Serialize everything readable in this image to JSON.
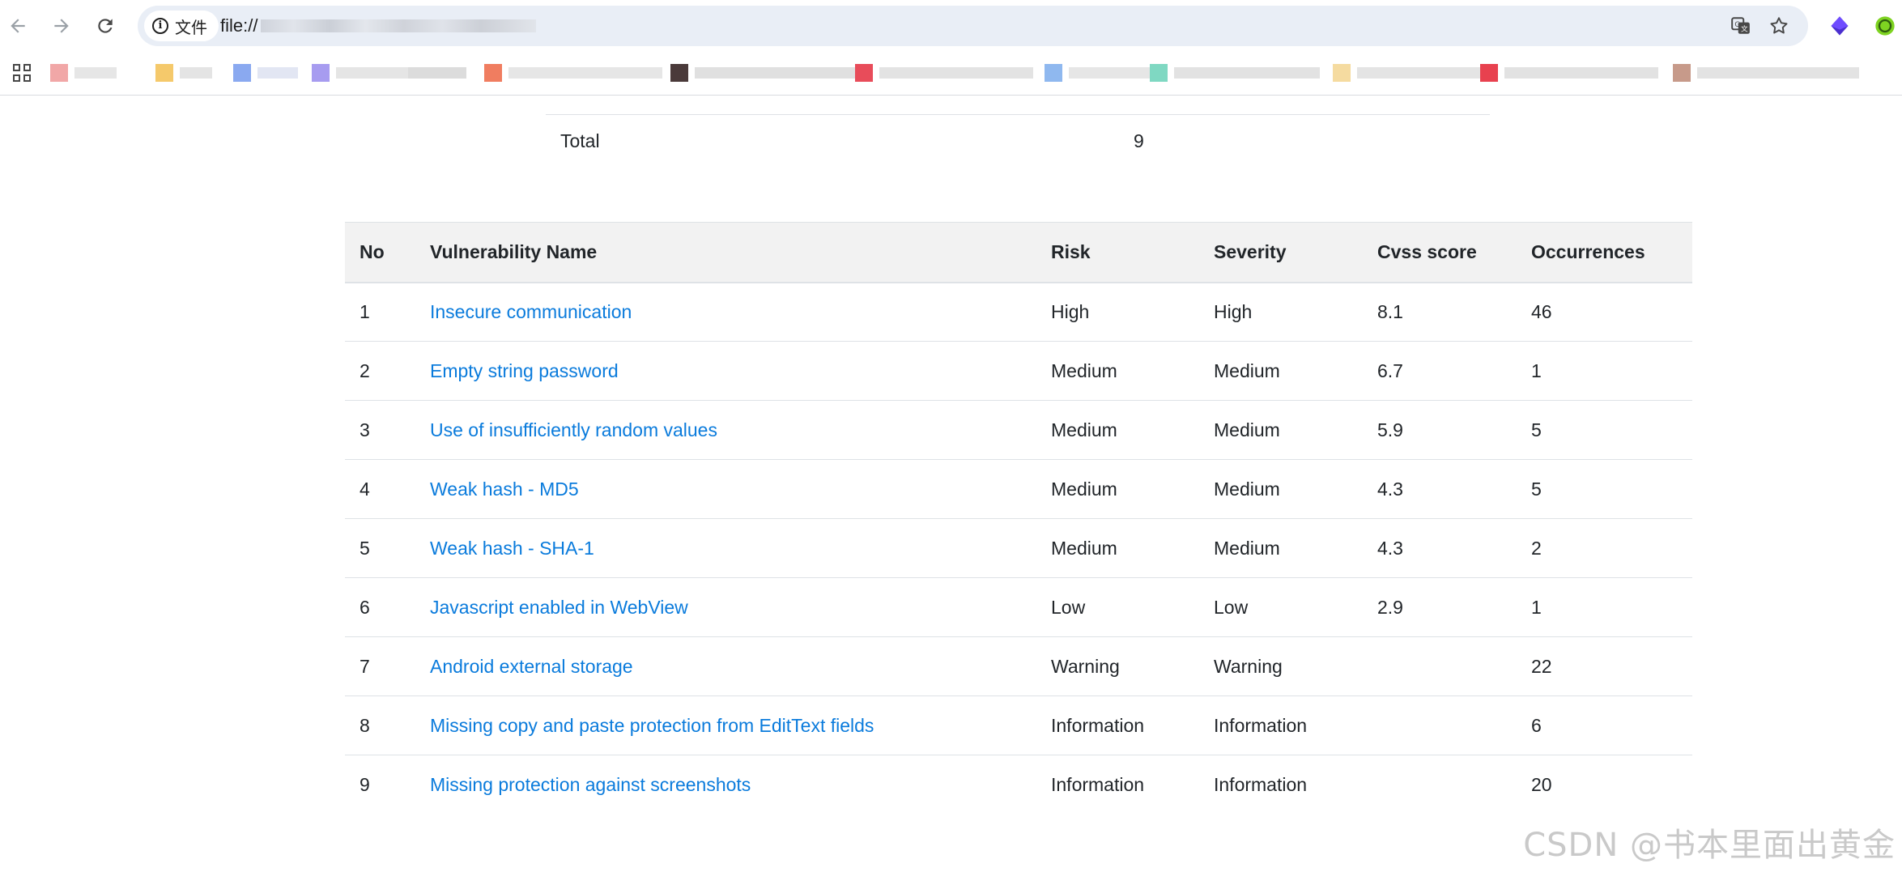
{
  "browser": {
    "site_chip_label": "文件",
    "url_prefix": "file://"
  },
  "summary": {
    "total_label": "Total",
    "total_value": "9"
  },
  "table": {
    "headers": {
      "no": "No",
      "name": "Vulnerability Name",
      "risk": "Risk",
      "severity": "Severity",
      "cvss": "Cvss score",
      "occurrences": "Occurrences"
    },
    "rows": [
      {
        "no": "1",
        "name": "Insecure communication",
        "risk": "High",
        "severity": "High",
        "cvss": "8.1",
        "occurrences": "46"
      },
      {
        "no": "2",
        "name": "Empty string password",
        "risk": "Medium",
        "severity": "Medium",
        "cvss": "6.7",
        "occurrences": "1"
      },
      {
        "no": "3",
        "name": "Use of insufficiently random values",
        "risk": "Medium",
        "severity": "Medium",
        "cvss": "5.9",
        "occurrences": "5"
      },
      {
        "no": "4",
        "name": "Weak hash - MD5",
        "risk": "Medium",
        "severity": "Medium",
        "cvss": "4.3",
        "occurrences": "5"
      },
      {
        "no": "5",
        "name": "Weak hash - SHA-1",
        "risk": "Medium",
        "severity": "Medium",
        "cvss": "4.3",
        "occurrences": "2"
      },
      {
        "no": "6",
        "name": "Javascript enabled in WebView",
        "risk": "Low",
        "severity": "Low",
        "cvss": "2.9",
        "occurrences": "1"
      },
      {
        "no": "7",
        "name": "Android external storage",
        "risk": "Warning",
        "severity": "Warning",
        "cvss": "",
        "occurrences": "22"
      },
      {
        "no": "8",
        "name": "Missing copy and paste protection from EditText fields",
        "risk": "Information",
        "severity": "Information",
        "cvss": "",
        "occurrences": "6"
      },
      {
        "no": "9",
        "name": "Missing protection against screenshots",
        "risk": "Information",
        "severity": "Information",
        "cvss": "",
        "occurrences": "20"
      }
    ]
  },
  "watermark": "CSDN @书本里面出黄金",
  "colors": {
    "link": "#0a7bdc",
    "header_bg": "#f2f2f2",
    "border": "#dee2e6",
    "omnibox_bg": "#e9eef6"
  }
}
